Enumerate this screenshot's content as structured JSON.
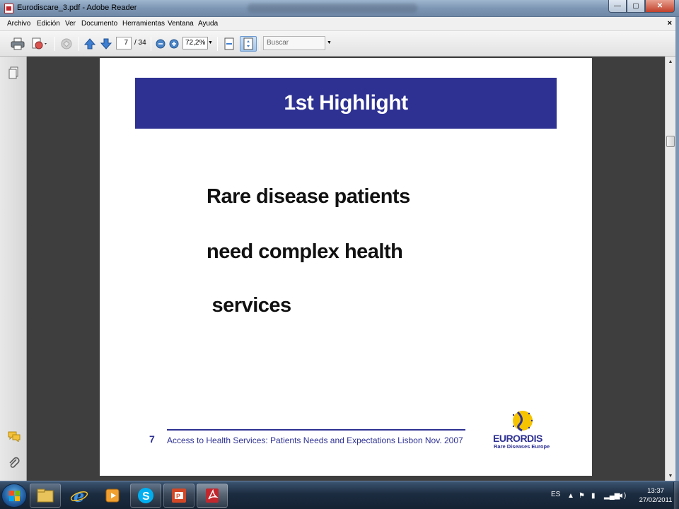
{
  "window": {
    "title": "Eurodiscare_3.pdf - Adobe Reader",
    "buttons": {
      "minimize": "—",
      "maximize": "▢",
      "close": "✕"
    }
  },
  "menu": {
    "items": [
      "Archivo",
      "Edición",
      "Ver",
      "Documento",
      "Herramientas",
      "Ventana",
      "Ayuda"
    ],
    "close_doc": "×"
  },
  "toolbar": {
    "current_page": "7",
    "total_pages": "/ 34",
    "zoom": "72,2%",
    "search_placeholder": "Buscar",
    "icons": [
      "print-icon",
      "save-edit-icon",
      "collaborate-icon",
      "prev-page-icon",
      "next-page-icon",
      "zoom-out-icon",
      "zoom-in-icon",
      "fit-width-icon",
      "fit-page-icon"
    ]
  },
  "document": {
    "banner_title": "1st Highlight",
    "body_lines": [
      "Rare disease patients",
      "need complex health",
      " services"
    ],
    "footer_page": "7",
    "footer_text": "Access to Health Services: Patients Needs and Expectations Lisbon Nov. 2007",
    "logo_name": "EURORDIS",
    "logo_sub": "Rare Diseases Europe"
  },
  "taskbar": {
    "apps": [
      "explorer-icon",
      "internet-explorer-icon",
      "media-player-icon",
      "skype-icon",
      "powerpoint-icon",
      "adobe-reader-icon"
    ],
    "language": "ES",
    "time": "13:37",
    "date": "27/02/2011"
  },
  "colors": {
    "banner": "#2e3192",
    "footer": "#2e3192",
    "logo_yellow": "#f6c400"
  }
}
